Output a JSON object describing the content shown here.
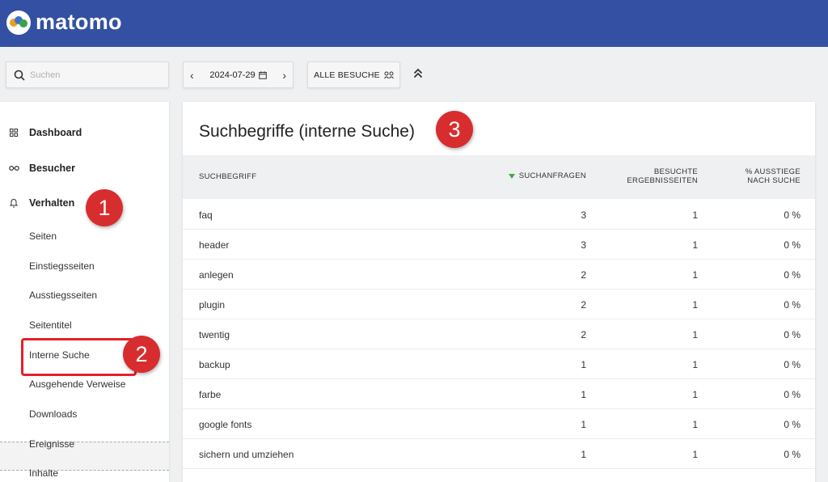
{
  "brand": {
    "name": "matomo"
  },
  "search": {
    "placeholder": "Suchen"
  },
  "period": {
    "date": "2024-07-29"
  },
  "segment": {
    "label": "ALLE BESUCHE"
  },
  "sidebar": {
    "top_items": [
      {
        "label": "Dashboard"
      },
      {
        "label": "Besucher"
      },
      {
        "label": "Verhalten"
      }
    ],
    "sub_items": [
      {
        "label": "Seiten"
      },
      {
        "label": "Einstiegsseiten"
      },
      {
        "label": "Ausstiegsseiten"
      },
      {
        "label": "Seitentitel"
      },
      {
        "label": "Interne Suche"
      },
      {
        "label": "Ausgehende Verweise"
      },
      {
        "label": "Downloads"
      },
      {
        "label": "Ereignisse"
      },
      {
        "label": "Inhalte"
      }
    ],
    "active_item": "Interne Suche"
  },
  "annotations": {
    "one": "1",
    "two": "2",
    "three": "3"
  },
  "report": {
    "title": "Suchbegriffe (interne Suche)",
    "columns": {
      "label": "SUCHBEGRIFF",
      "searches": "SUCHANFRAGEN",
      "pages_line1": "BESUCHTE",
      "pages_line2": "ERGEBNISSEITEN",
      "exit_line1": "% AUSSTIEGE",
      "exit_line2": "NACH SUCHE"
    },
    "rows": [
      {
        "label": "faq",
        "searches": "3",
        "pages": "1",
        "exit": "0 %"
      },
      {
        "label": "header",
        "searches": "3",
        "pages": "1",
        "exit": "0 %"
      },
      {
        "label": "anlegen",
        "searches": "2",
        "pages": "1",
        "exit": "0 %"
      },
      {
        "label": "plugin",
        "searches": "2",
        "pages": "1",
        "exit": "0 %"
      },
      {
        "label": "twentig",
        "searches": "2",
        "pages": "1",
        "exit": "0 %"
      },
      {
        "label": "backup",
        "searches": "1",
        "pages": "1",
        "exit": "0 %"
      },
      {
        "label": "farbe",
        "searches": "1",
        "pages": "1",
        "exit": "0 %"
      },
      {
        "label": "google fonts",
        "searches": "1",
        "pages": "1",
        "exit": "0 %"
      },
      {
        "label": "sichern und umziehen",
        "searches": "1",
        "pages": "1",
        "exit": "0 %"
      }
    ]
  },
  "colors": {
    "topbar": "#3450a3",
    "badge": "#d72d2e",
    "highlight": "#e5202a",
    "sort": "#42a944"
  }
}
